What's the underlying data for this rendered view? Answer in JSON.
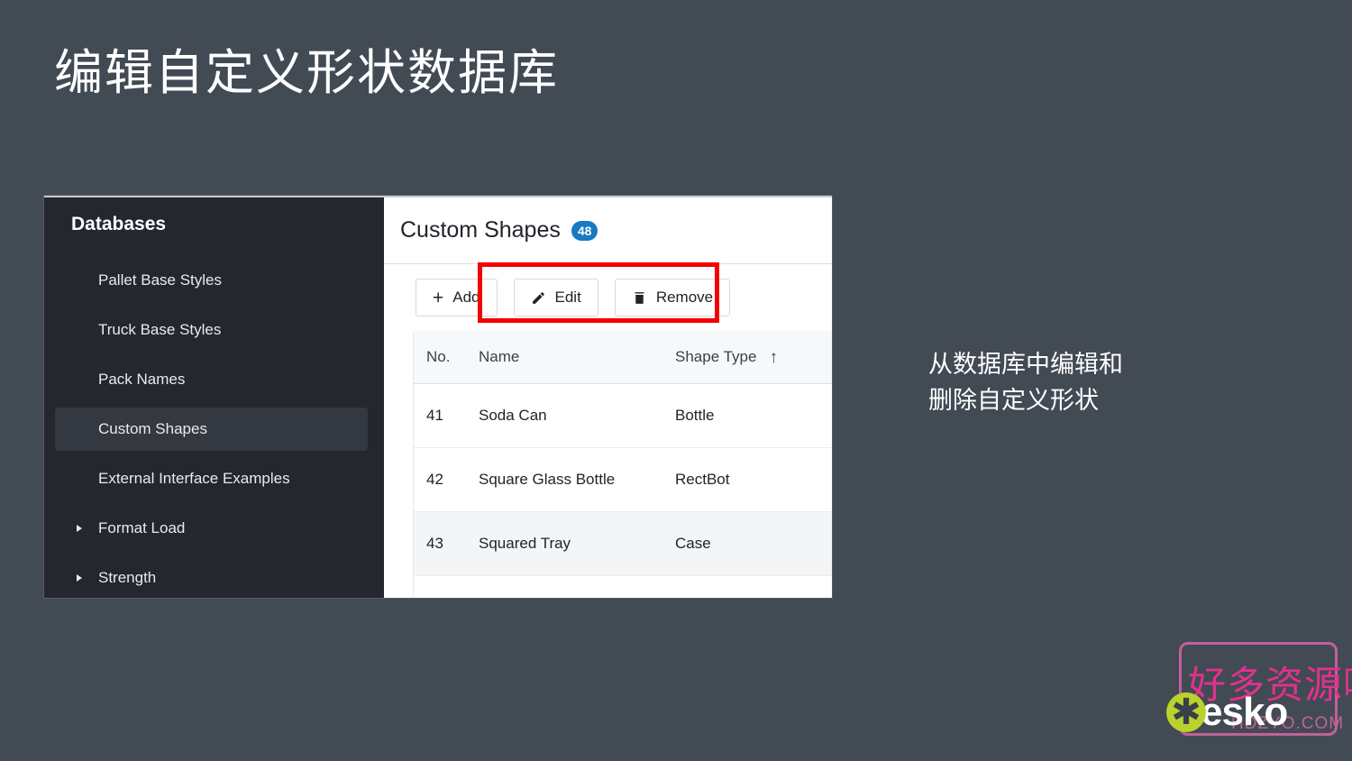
{
  "slide": {
    "title": "编辑自定义形状数据库",
    "caption": "从数据库中编辑和删除自定义形状",
    "background_color": "#424a54"
  },
  "sidebar": {
    "title": "Databases",
    "panel_color": "#24272d",
    "selected_item_color": "#343840",
    "items": [
      {
        "label": "Pallet Base Styles",
        "selected": false,
        "expandable": false
      },
      {
        "label": "Truck Base Styles",
        "selected": false,
        "expandable": false
      },
      {
        "label": "Pack Names",
        "selected": false,
        "expandable": false
      },
      {
        "label": "Custom Shapes",
        "selected": true,
        "expandable": false
      },
      {
        "label": "External Interface Examples",
        "selected": false,
        "expandable": false
      },
      {
        "label": "Format Load",
        "selected": false,
        "expandable": true
      },
      {
        "label": "Strength",
        "selected": false,
        "expandable": true
      }
    ]
  },
  "main": {
    "header": {
      "title": "Custom Shapes",
      "count": "48",
      "badge_color": "#1879c4"
    },
    "toolbar": {
      "add_label": "Add",
      "edit_label": "Edit",
      "remove_label": "Remove",
      "highlight_color": "#f40000"
    },
    "table": {
      "columns": [
        "No.",
        "Name",
        "Shape Type"
      ],
      "sort_column": "Shape Type",
      "sort_indicator": "↑",
      "rows": [
        {
          "no": "41",
          "name": "Soda Can",
          "type": "Bottle",
          "highlighted": false
        },
        {
          "no": "42",
          "name": "Square Glass Bottle",
          "type": "RectBot",
          "highlighted": false
        },
        {
          "no": "43",
          "name": "Squared Tray",
          "type": "Case",
          "highlighted": true
        }
      ]
    }
  },
  "watermark": {
    "chinese": "好多资源哦",
    "url": "HDZYO.COM",
    "brand": "esko",
    "brand_color": "#b9d22e",
    "text_color": "#e0328c"
  }
}
